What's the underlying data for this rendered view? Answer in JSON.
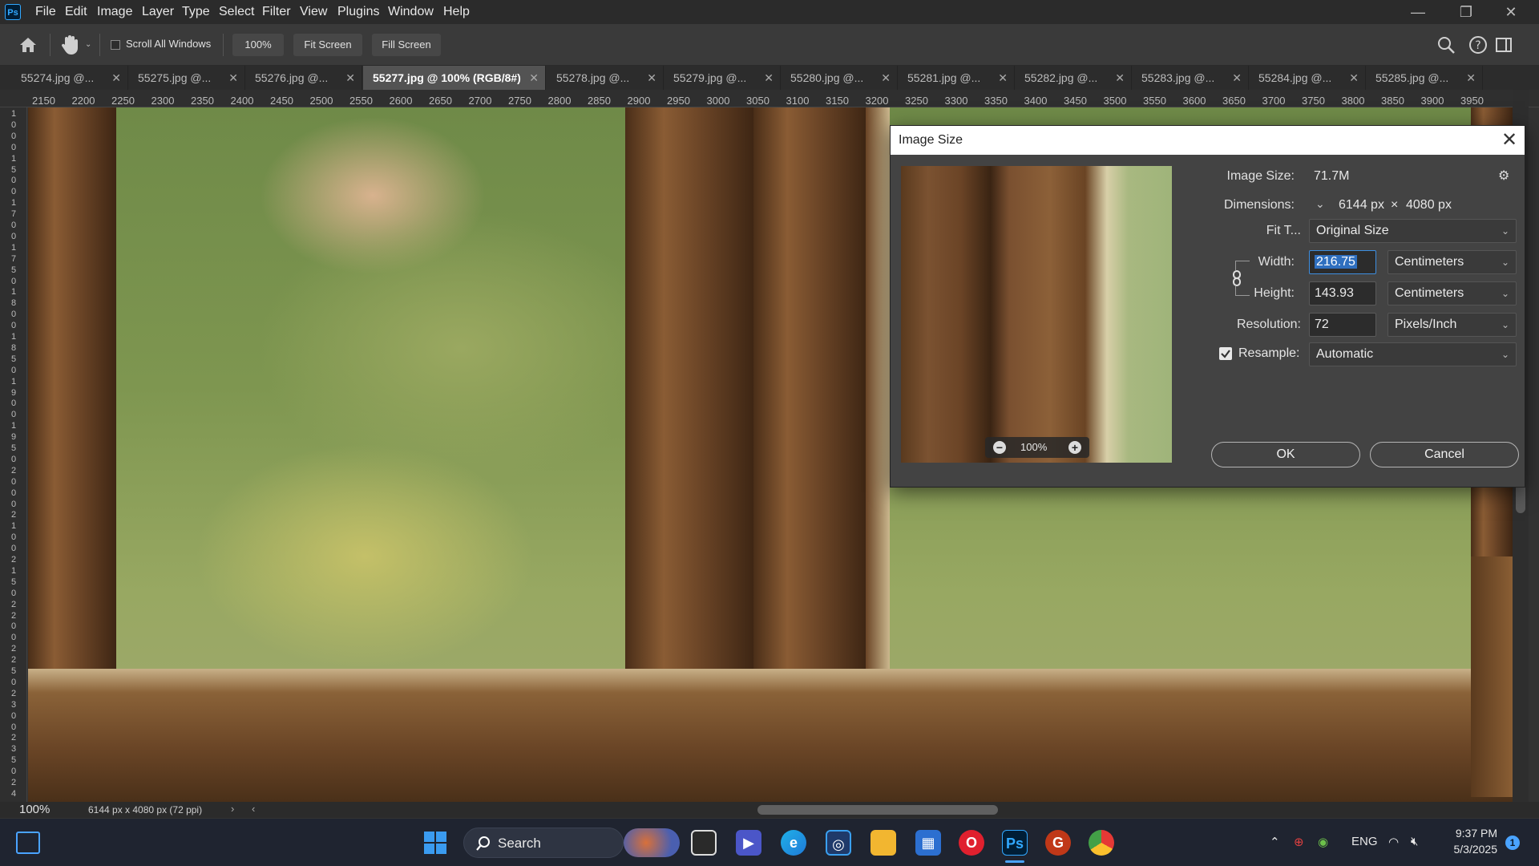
{
  "app": {
    "logo": "Ps",
    "brand_color": "#31a8ff"
  },
  "menu": [
    "File",
    "Edit",
    "Image",
    "Layer",
    "Type",
    "Select",
    "Filter",
    "View",
    "Plugins",
    "Window",
    "Help"
  ],
  "window_controls": {
    "minimize": "—",
    "restore": "❐",
    "close": "✕"
  },
  "options": {
    "scroll_all_windows": "Scroll All Windows",
    "zoom": "100%",
    "fit_screen": "Fit Screen",
    "fill_screen": "Fill Screen"
  },
  "tabs": [
    {
      "label": "55274.jpg @..."
    },
    {
      "label": "55275.jpg @..."
    },
    {
      "label": "55276.jpg @..."
    },
    {
      "label": "55277.jpg @ 100% (RGB/8#)",
      "active": true
    },
    {
      "label": "55278.jpg @..."
    },
    {
      "label": "55279.jpg @..."
    },
    {
      "label": "55280.jpg @..."
    },
    {
      "label": "55281.jpg @..."
    },
    {
      "label": "55282.jpg @..."
    },
    {
      "label": "55283.jpg @..."
    },
    {
      "label": "55284.jpg @..."
    },
    {
      "label": "55285.jpg @..."
    }
  ],
  "ruler_top": [
    "2150",
    "2200",
    "2250",
    "2300",
    "2350",
    "2400",
    "2450",
    "2500",
    "2550",
    "2600",
    "2650",
    "2700",
    "2750",
    "2800",
    "2850",
    "2900",
    "2950",
    "3000",
    "3050",
    "3100",
    "3150",
    "3200",
    "3250",
    "3300",
    "3350",
    "3400",
    "3450",
    "3500",
    "3550",
    "3600",
    "3650",
    "3700",
    "3750",
    "3800",
    "3850",
    "3900",
    "3950"
  ],
  "ruler_left": [
    "1",
    "0",
    "0",
    "0",
    "1",
    "5",
    "0",
    "0",
    "1",
    "7",
    "0",
    "0",
    "1",
    "7",
    "5",
    "0",
    "1",
    "8",
    "0",
    "0",
    "1",
    "8",
    "5",
    "0",
    "1",
    "9",
    "0",
    "0",
    "1",
    "9",
    "5",
    "0",
    "2",
    "0",
    "0",
    "0",
    "2",
    "1",
    "0",
    "0",
    "2",
    "1",
    "5",
    "0",
    "2",
    "2",
    "0",
    "0",
    "2",
    "2",
    "5",
    "0",
    "2",
    "3",
    "0",
    "0",
    "2",
    "3",
    "5",
    "0",
    "2",
    "4"
  ],
  "status": {
    "zoom": "100%",
    "doc_info": "6144 px x 4080 px (72 ppi)"
  },
  "dialog": {
    "title": "Image Size",
    "preview_zoom": "100%",
    "image_size_label": "Image Size:",
    "image_size_value": "71.7M",
    "dimensions_label": "Dimensions:",
    "dim_width": "6144 px",
    "dim_times": "×",
    "dim_height": "4080 px",
    "fit_label": "Fit T...",
    "fit_value": "Original Size",
    "width_label": "Width:",
    "width_value": "216.75",
    "width_unit": "Centimeters",
    "height_label": "Height:",
    "height_value": "143.93",
    "height_unit": "Centimeters",
    "resolution_label": "Resolution:",
    "resolution_value": "72",
    "resolution_unit": "Pixels/Inch",
    "resample_label": "Resample:",
    "resample_checked": true,
    "resample_value": "Automatic",
    "ok": "OK",
    "cancel": "Cancel"
  },
  "taskbar": {
    "search": "Search",
    "lang": "ENG",
    "time": "9:37 PM",
    "date": "5/3/2025",
    "notification_count": "1"
  }
}
